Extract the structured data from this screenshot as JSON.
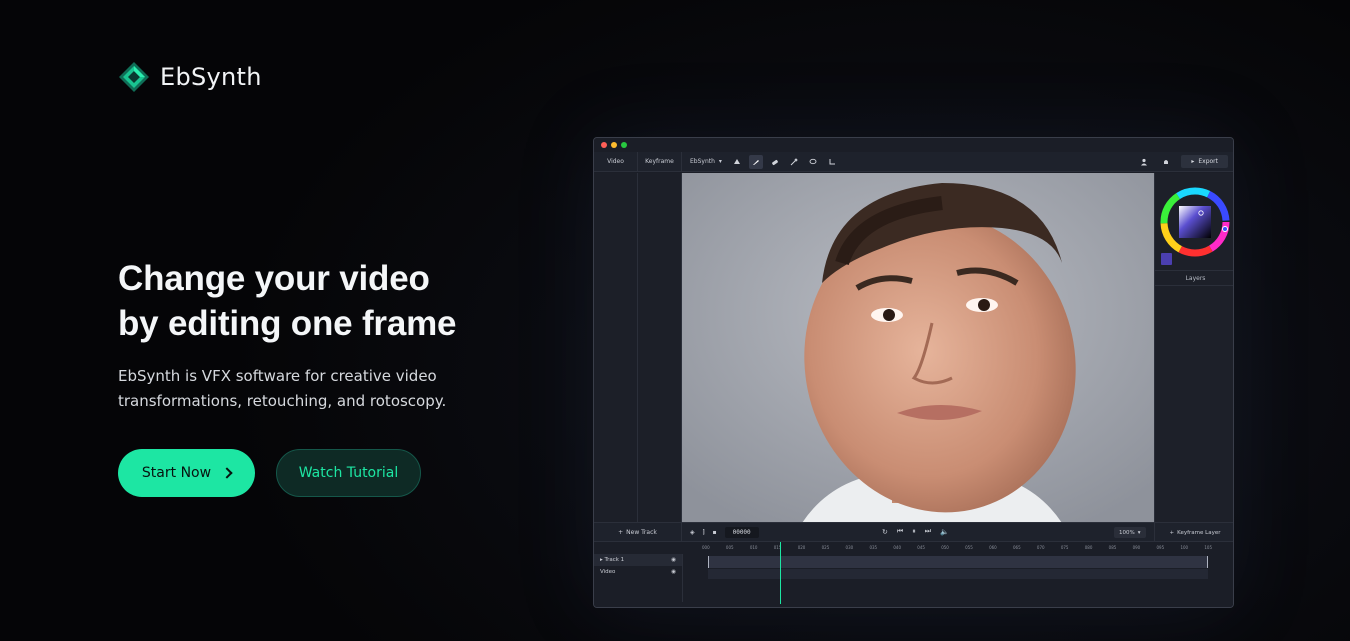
{
  "brand": {
    "name": "EbSynth",
    "accent": "#1de6a3",
    "logo_icon": "diamond-logo-icon"
  },
  "hero": {
    "title_line1": "Change your video",
    "title_line2": "by editing one frame",
    "subtitle_line1": "EbSynth is VFX software for creative video",
    "subtitle_line2": "transformations, retouching, and rotoscopy.",
    "primary_cta": "Start Now",
    "secondary_cta": "Watch Tutorial"
  },
  "app": {
    "tabs": [
      "Video",
      "Keyframe"
    ],
    "mode_select": "EbSynth",
    "tools": [
      "fill-icon",
      "brush-icon",
      "eraser-icon",
      "eyedropper-icon",
      "lasso-icon",
      "transform-icon"
    ],
    "export_label": "Export",
    "layers_label": "Layers",
    "swatch_color": "#4b3fb0",
    "new_track_label": "New Track",
    "frame_value": "00000",
    "zoom_value": "100%",
    "keyframe_layer_label": "Keyframe Layer",
    "tracks": [
      "Track 1",
      "Video"
    ],
    "ruler_ticks": [
      "000",
      "005",
      "010",
      "015",
      "020",
      "025",
      "030",
      "035",
      "040",
      "045",
      "050",
      "055",
      "060",
      "065",
      "070",
      "075",
      "080",
      "085",
      "090",
      "095",
      "100",
      "105"
    ]
  }
}
